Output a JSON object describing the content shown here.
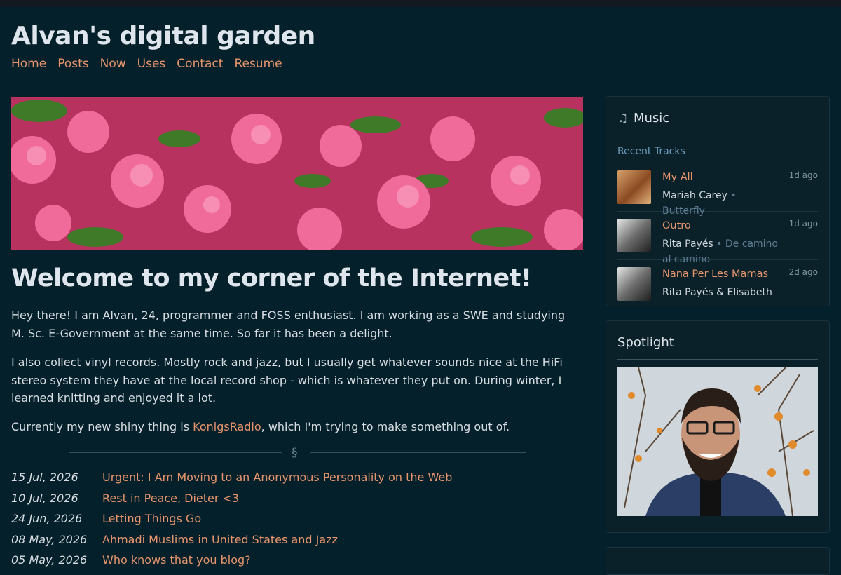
{
  "site": {
    "title": "Alvan's digital garden"
  },
  "nav": [
    "Home",
    "Posts",
    "Now",
    "Uses",
    "Contact",
    "Resume"
  ],
  "hero": {
    "alt": "pink azalea flowers"
  },
  "welcome": "Welcome to my corner of the Internet!",
  "intro": {
    "p1": "Hey there! I am Alvan, 24, programmer and FOSS enthusiast. I am working as a SWE and studying M. Sc. E-Government at the same time. So far it has been a delight.",
    "p2": "I also collect vinyl records. Mostly rock and jazz, but I usually get whatever sounds nice at the HiFi stereo system they have at the local record shop - which is whatever they put on. During winter, I learned knitting and enjoyed it a lot.",
    "p3_before": "Currently my new shiny thing is ",
    "p3_link": "KonigsRadio",
    "p3_after": ", which I'm trying to make something out of."
  },
  "divider": "§",
  "posts": [
    {
      "date": "15 Jul, 2026",
      "title": "Urgent: I Am Moving to an Anonymous Personality on the Web"
    },
    {
      "date": "10 Jul, 2026",
      "title": "Rest in Peace, Dieter <3"
    },
    {
      "date": "24 Jun, 2026",
      "title": "Letting Things Go"
    },
    {
      "date": "08 May, 2026",
      "title": "Ahmadi Muslims in United States and Jazz"
    },
    {
      "date": "05 May, 2026",
      "title": "Who knows that you blog?"
    }
  ],
  "music": {
    "icon": "music-note-icon",
    "heading": "Music",
    "recent_label": "Recent Tracks",
    "tracks": [
      {
        "title": "My All",
        "artist": "Mariah Carey",
        "album": "Butterfly",
        "ago": "1d ago"
      },
      {
        "title": "Outro",
        "artist": "Rita Payés",
        "album": "De camino al camino",
        "ago": "1d ago"
      },
      {
        "title": "Nana Per Les Mamas",
        "artist": "Rita Payés & Elisabeth",
        "album": "",
        "ago": "2d ago"
      }
    ]
  },
  "spotlight": {
    "heading": "Spotlight"
  }
}
